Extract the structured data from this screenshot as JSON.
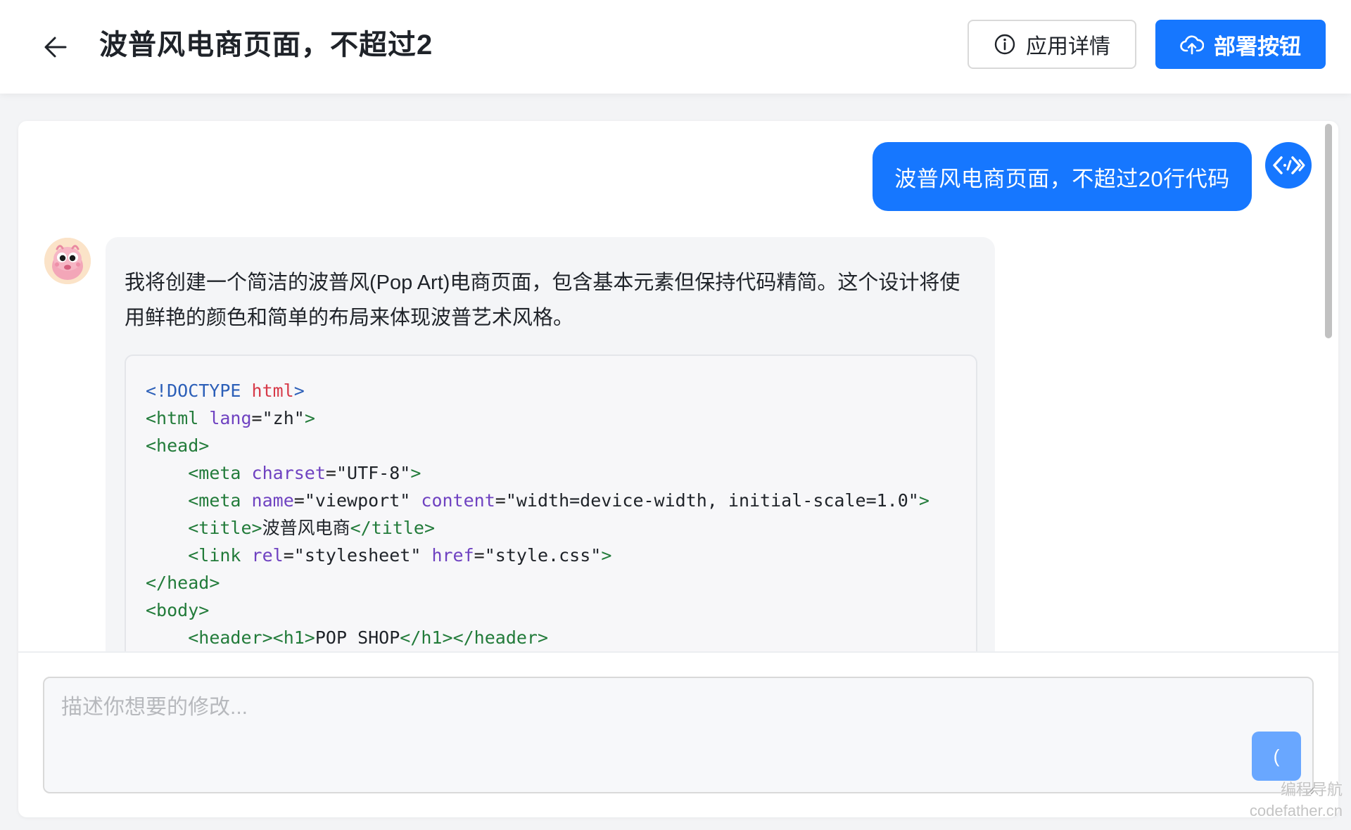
{
  "header": {
    "title": "波普风电商页面，不超过2",
    "detail_label": "应用详情",
    "deploy_label": "部署按钮"
  },
  "chat": {
    "user_message": "波普风电商页面，不超过20行代码",
    "ai_intro": "我将创建一个简洁的波普风(Pop Art)电商页面，包含基本元素但保持代码精简。这个设计将使用鲜艳的颜色和简单的布局来体现波普艺术风格。",
    "code_lines": [
      "<!DOCTYPE html>",
      "<html lang=\"zh\">",
      "<head>",
      "    <meta charset=\"UTF-8\">",
      "    <meta name=\"viewport\" content=\"width=device-width, initial-scale=1.0\">",
      "    <title>波普风电商</title>",
      "    <link rel=\"stylesheet\" href=\"style.css\">",
      "</head>",
      "<body>",
      "    <header><h1>POP SHOP</h1></header>"
    ]
  },
  "composer": {
    "placeholder": "描述你想要的修改...",
    "send_label": "("
  },
  "watermark": {
    "line1": "编程导航",
    "line2": "codefather.cn"
  },
  "colors": {
    "primary": "#1677ff",
    "send_disabled": "#69a7ff"
  },
  "icons": {
    "back": "arrow-left-icon",
    "info": "info-circle-icon",
    "deploy": "cloud-upload-icon",
    "user_avatar": "code-brackets-icon",
    "ai_avatar": "mascot-icon"
  }
}
